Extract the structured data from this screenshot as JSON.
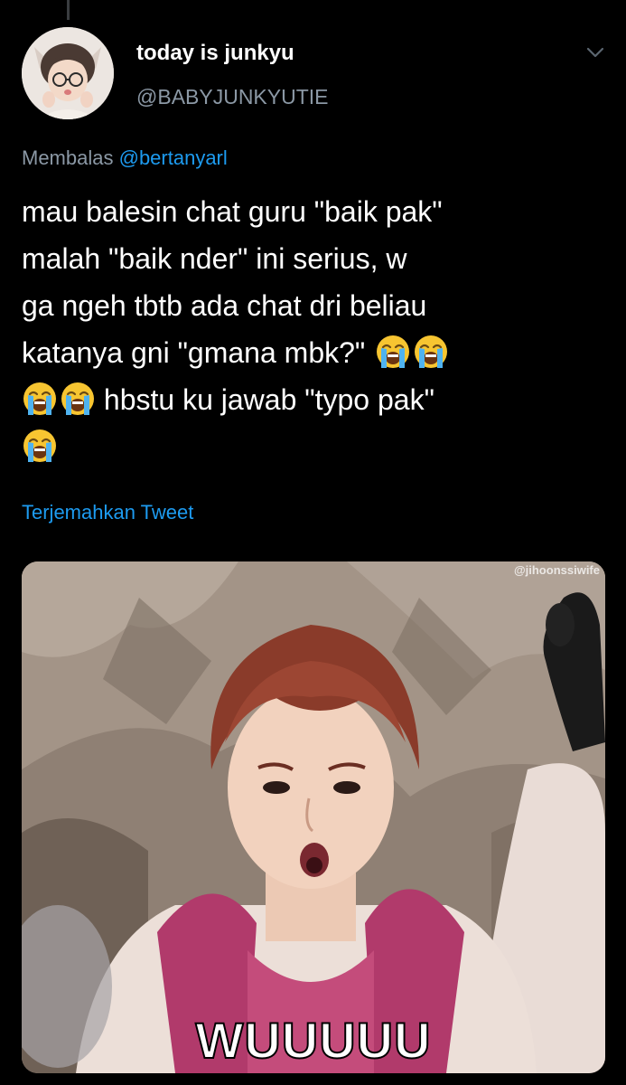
{
  "author": {
    "display_name": "today is junkyu",
    "handle": "@BABYJUNKYUTIE"
  },
  "reply": {
    "prefix": "Membalas",
    "mention": "@bertanyarl"
  },
  "tweet": {
    "lines": [
      "mau balesin chat guru \"baik pak\"",
      "malah \"baik nder\" ini serius, w",
      "ga ngeh tbtb ada chat dri beliau",
      "katanya gni \"gmana mbk?\" ",
      " hbstu ku jawab \"typo pak\"",
      ""
    ],
    "emoji_name": "loudly-crying-face"
  },
  "translate_label": "Terjemahkan Tweet",
  "media": {
    "watermark": "@jihoonssiwife",
    "caption": "WUUUUU"
  },
  "icons": {
    "menu": "chevron-down-icon"
  },
  "colors": {
    "background": "#000000",
    "link": "#1d9bf0",
    "secondary_text": "#8b98a5"
  }
}
